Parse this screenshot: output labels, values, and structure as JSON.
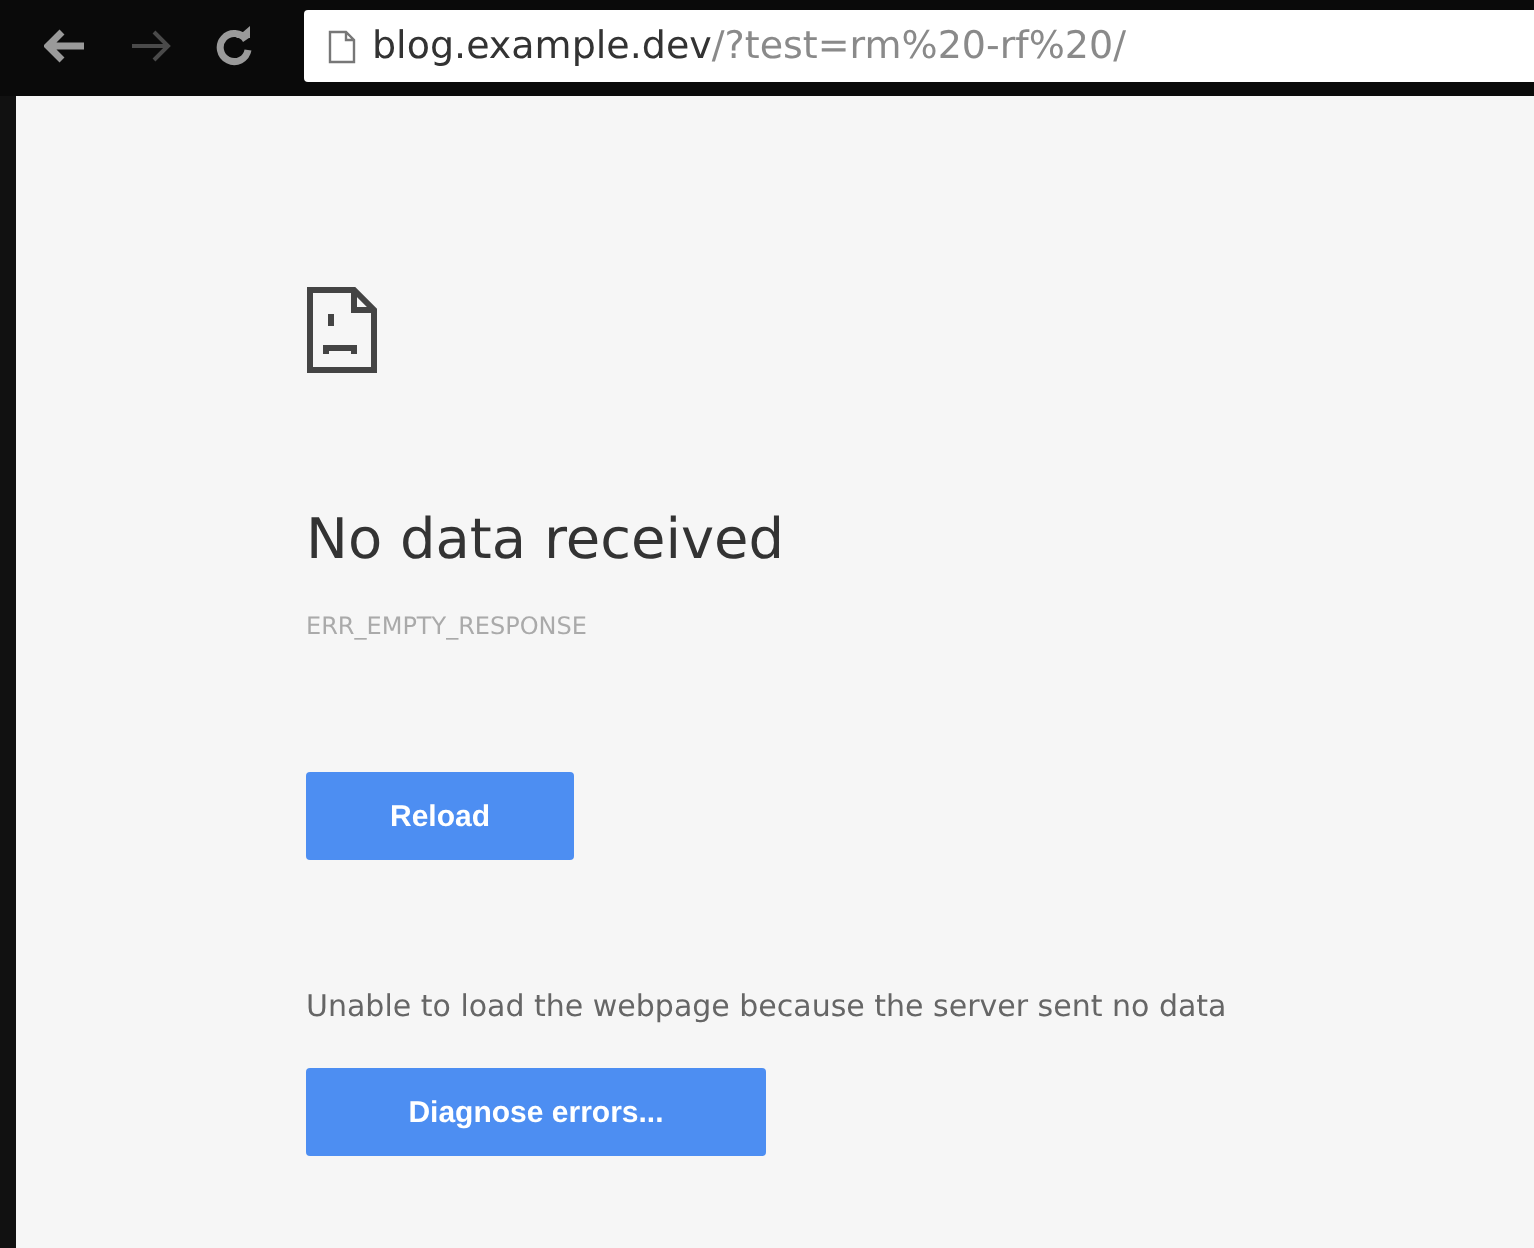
{
  "toolbar": {
    "nav_buttons": [
      {
        "kind": "back",
        "disabled": false
      },
      {
        "kind": "forward",
        "disabled": true
      },
      {
        "kind": "reload",
        "disabled": false
      }
    ],
    "address": {
      "host": "blog.example.dev",
      "path": "/?test=rm%20-rf%20/"
    }
  },
  "error_page": {
    "title": "No data received",
    "code": "ERR_EMPTY_RESPONSE",
    "reload_button": "Reload",
    "message": "Unable to load the webpage because the server sent no data",
    "diagnose_button": "Diagnose errors..."
  }
}
